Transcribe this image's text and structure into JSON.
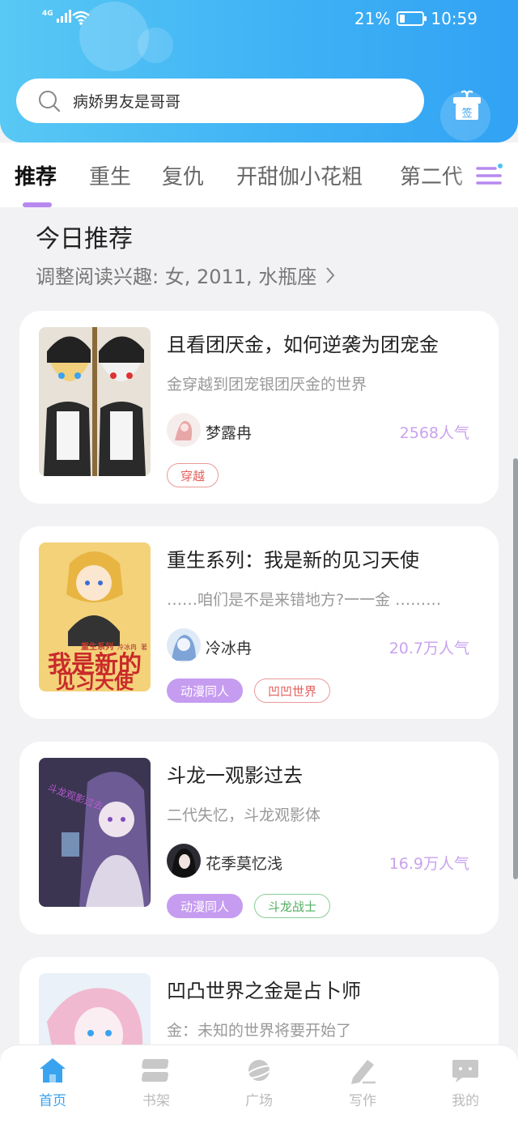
{
  "status": {
    "signal_tag": "4G",
    "battery": "21%",
    "time": "10:59"
  },
  "search": {
    "query": "病娇男友是哥哥"
  },
  "gift_button": {
    "label": "签"
  },
  "tabs": [
    {
      "label": "推荐"
    },
    {
      "label": "重生"
    },
    {
      "label": "复仇"
    },
    {
      "label": "开甜伽小花粗"
    },
    {
      "label": "第二代"
    }
  ],
  "section": {
    "title": "今日推荐",
    "subtitle": "调整阅读兴趣: 女, 2011, 水瓶座"
  },
  "books": [
    {
      "title": "且看团厌金，如何逆袭为团宠金",
      "desc": "金穿越到团宠银团厌金的世界",
      "author": "梦露冉",
      "popularity": "2568人气",
      "tags": [
        {
          "label": "穿越"
        }
      ]
    },
    {
      "title": "重生系列：我是新的见习天使",
      "desc": "……咱们是不是来错地方?一一金 ………",
      "author": "冷冰冉",
      "popularity": "20.7万人气",
      "tags": [
        {
          "label": "动漫同人"
        },
        {
          "label": "凹凹世界"
        }
      ],
      "cover_text": {
        "series": "重生系列",
        "author": "冷冰冉",
        "suffix": "著",
        "line1": "我是新的",
        "line2": "见习天使"
      }
    },
    {
      "title": "斗龙一观影过去",
      "desc": "二代失忆，斗龙观影体",
      "author": "花季莫忆浅",
      "popularity": "16.9万人气",
      "tags": [
        {
          "label": "动漫同人"
        },
        {
          "label": "斗龙战士"
        }
      ],
      "cover_text": {
        "line1": "斗龙观影过去"
      }
    },
    {
      "title": "凹凸世界之金是占卜师",
      "desc": "金：未知的世界将要开始了"
    }
  ],
  "nav": [
    {
      "label": "首页"
    },
    {
      "label": "书架"
    },
    {
      "label": "广场"
    },
    {
      "label": "写作"
    },
    {
      "label": "我的"
    }
  ],
  "colors": {
    "header": "#3fb2f5",
    "accent_purple": "#b788f0",
    "nav_active": "#3aa3f0"
  }
}
